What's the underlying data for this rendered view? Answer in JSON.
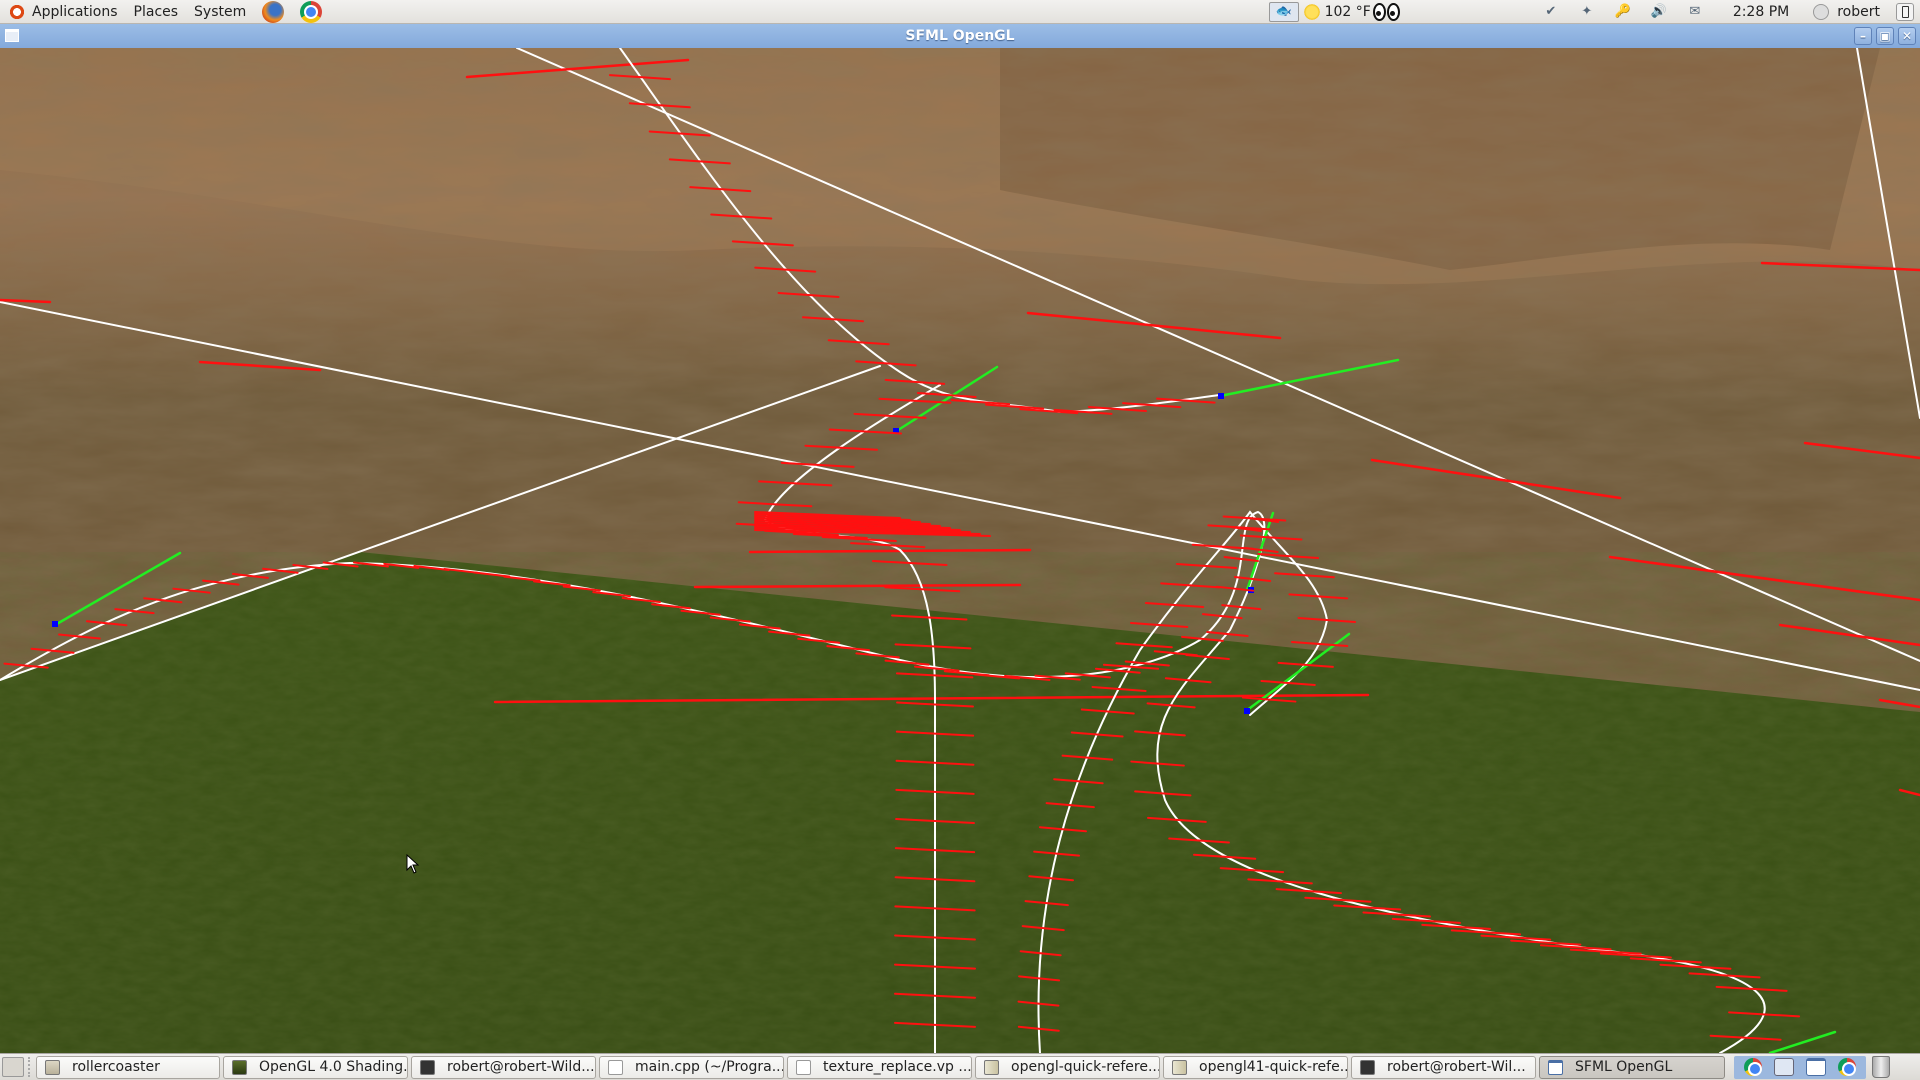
{
  "top_panel": {
    "menus": [
      "Applications",
      "Places",
      "System"
    ],
    "launchers": [
      "firefox-icon",
      "chrome-icon"
    ],
    "weather_temp": "102 °F",
    "clock": "2:28 PM",
    "user": "robert"
  },
  "window": {
    "title": "SFML OpenGL",
    "buttons": [
      "minimize",
      "maximize",
      "close"
    ]
  },
  "scene": {
    "description": "3D rollercoaster track rendered over terrain",
    "colors": {
      "sky_terrain": "#7d5d3c",
      "ground": "#3f5418",
      "track_spline": "#ffffff",
      "rail_ties": "#ff0000",
      "tangent": "#22ee22",
      "control_point": "#0000ff"
    }
  },
  "taskbar": {
    "tasks": [
      {
        "label": "rollercoaster",
        "icon": "folder",
        "active": false
      },
      {
        "label": "OpenGL 4.0 Shading...",
        "icon": "book",
        "active": false
      },
      {
        "label": "robert@robert-Wild...",
        "icon": "term",
        "active": false
      },
      {
        "label": "main.cpp (~/Progra...",
        "icon": "edit",
        "active": false
      },
      {
        "label": "texture_replace.vp ...",
        "icon": "edit",
        "active": false
      },
      {
        "label": "opengl-quick-refere...",
        "icon": "doc",
        "active": false
      },
      {
        "label": "opengl41-quick-refe...",
        "icon": "doc",
        "active": false
      },
      {
        "label": "robert@robert-Wil...",
        "icon": "term",
        "active": false
      },
      {
        "label": "SFML OpenGL",
        "icon": "win",
        "active": true
      }
    ]
  }
}
